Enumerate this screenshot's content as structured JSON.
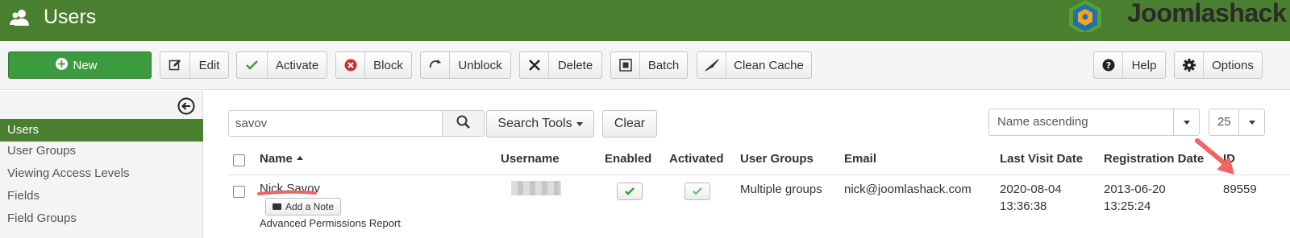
{
  "header": {
    "title": "Users",
    "logo_text": "Joomlashack",
    "logo_colors": {
      "orange": "#f2a41c",
      "blue": "#1f6fb5",
      "green": "#5aa02c"
    }
  },
  "toolbar": {
    "new": "New",
    "edit": "Edit",
    "activate": "Activate",
    "block": "Block",
    "unblock": "Unblock",
    "delete": "Delete",
    "batch": "Batch",
    "clean_cache": "Clean Cache",
    "help": "Help",
    "options": "Options"
  },
  "sidebar": {
    "items": [
      {
        "label": "Users",
        "active": true
      },
      {
        "label": "User Groups"
      },
      {
        "label": "Viewing Access Levels"
      },
      {
        "label": "Fields"
      },
      {
        "label": "Field Groups"
      }
    ]
  },
  "filters": {
    "search_value": "savov",
    "search_tools": "Search Tools",
    "clear": "Clear",
    "sort": "Name ascending",
    "limit": "25"
  },
  "table": {
    "columns": {
      "name": "Name",
      "username": "Username",
      "enabled": "Enabled",
      "activated": "Activated",
      "groups": "User Groups",
      "email": "Email",
      "last_visit": "Last Visit Date",
      "registration": "Registration Date",
      "id": "ID"
    },
    "rows": [
      {
        "name": "Nick Savov",
        "add_note": "Add a Note",
        "permissions_link": "Advanced Permissions Report",
        "groups": "Multiple groups",
        "email": "nick@joomlashack.com",
        "last_visit_date": "2020-08-04",
        "last_visit_time": "13:36:38",
        "registration_date": "2013-06-20",
        "registration_time": "13:25:24",
        "id": "89559"
      }
    ]
  },
  "colors": {
    "accent": "#4b7f30",
    "new_button": "#3d9b3f",
    "annotation": "#f06464"
  }
}
